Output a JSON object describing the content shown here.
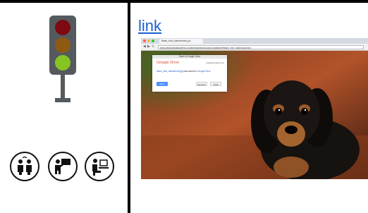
{
  "link_text": "link",
  "colors": {
    "traffic_red": "#7d0a12",
    "traffic_amber": "#8e5a12",
    "traffic_green": "#86c424",
    "link_blue": "#1a5fd0"
  },
  "icons": {
    "activity_icons": [
      "two-people-talking-icon",
      "teacher-at-board-icon",
      "person-at-computer-icon"
    ]
  },
  "screenshot": {
    "browser_tab_title": "black_mini_dachshund_pu",
    "url": "www.desktopwallpapers4.org/animals/small-puppy-wallpaper/black_mini_dachshund.jpg",
    "dialog": {
      "window_title": "Save to Google Drive",
      "service_name": "Google Drive",
      "account": "you@example.com",
      "message_file": "black_mini_dachshund.jpg",
      "message_middle": " was saved to ",
      "message_destination": "Google Drive",
      "open_label": "Open",
      "rename_label": "Rename",
      "trash_label": "Trash"
    }
  }
}
